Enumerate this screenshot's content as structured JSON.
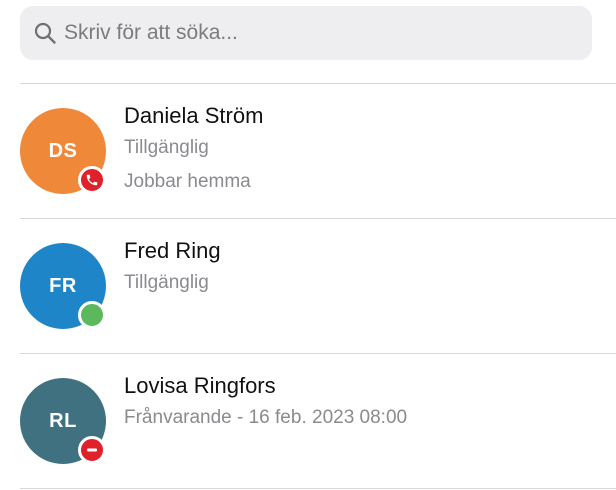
{
  "search": {
    "placeholder": "Skriv för att söka..."
  },
  "contacts": [
    {
      "initials": "DS",
      "name": "Daniela Ström",
      "availability": "Tillgänglig",
      "note": "Jobbar hemma",
      "avatar_color": "#f0883a",
      "status_icon": "phone-icon",
      "status_color": "#e0202b"
    },
    {
      "initials": "FR",
      "name": "Fred Ring",
      "availability": "Tillgänglig",
      "avatar_color": "#1e86c8",
      "status_icon": "available-icon",
      "status_color": "#5cb85c"
    },
    {
      "initials": "RL",
      "name": "Lovisa Ringfors",
      "availability": "Frånvarande - 16 feb. 2023 08:00",
      "avatar_color": "#3f7180",
      "status_icon": "do-not-disturb-icon",
      "status_color": "#e0202b"
    }
  ]
}
